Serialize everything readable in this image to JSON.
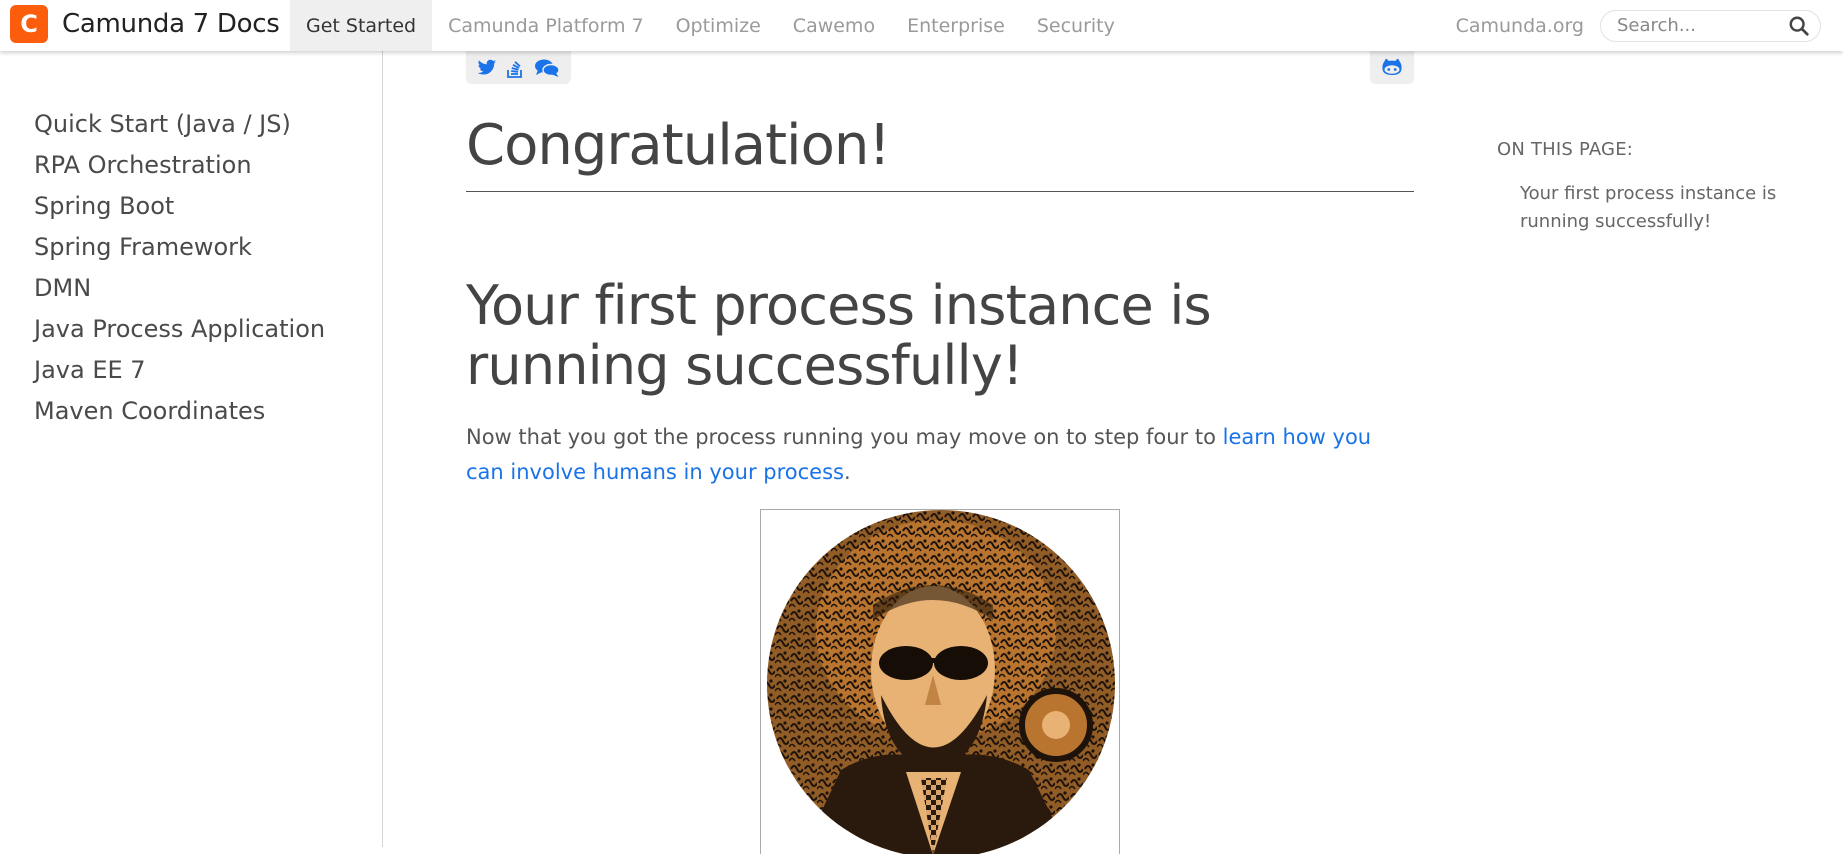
{
  "header": {
    "brand_logo_glyph": "C",
    "brand_title": "Camunda 7 Docs",
    "brand_color": "#fc5d0d",
    "nav_items": [
      {
        "label": "Get Started",
        "active": true
      },
      {
        "label": "Camunda Platform 7",
        "active": false
      },
      {
        "label": "Optimize",
        "active": false
      },
      {
        "label": "Cawemo",
        "active": false
      },
      {
        "label": "Enterprise",
        "active": false
      },
      {
        "label": "Security",
        "active": false
      }
    ],
    "right_link": "Camunda.org",
    "search": {
      "placeholder": "Search...",
      "value": "",
      "icon": "search-icon"
    }
  },
  "sidebar": {
    "items": [
      {
        "label": "Quick Start (Java / JS)"
      },
      {
        "label": "RPA Orchestration"
      },
      {
        "label": "Spring Boot"
      },
      {
        "label": "Spring Framework"
      },
      {
        "label": "DMN"
      },
      {
        "label": "Java Process Application"
      },
      {
        "label": "Java EE 7"
      },
      {
        "label": "Maven Coordinates"
      }
    ]
  },
  "share": {
    "icons": [
      "twitter-icon",
      "stack-overflow-icon",
      "forum-icon"
    ],
    "github_icon": "github-icon",
    "icon_color": "#1a73e8"
  },
  "main": {
    "title": "Congratulation!",
    "heading": "Your first process instance is running successfully!",
    "paragraph": {
      "text_before": "Now that you got the process running you may move on to step four to ",
      "link_text": "learn how you can involve humans in your process",
      "text_after": "."
    },
    "link_color": "#1a73e8"
  },
  "toc": {
    "title": "ON THIS PAGE:",
    "items": [
      {
        "label": "Your first process instance is running successfully!"
      }
    ]
  }
}
